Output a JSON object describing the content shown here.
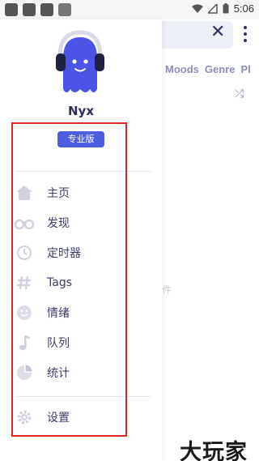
{
  "status_bar": {
    "time": "5:06"
  },
  "background": {
    "tabs": [
      "Moods",
      "Genre",
      "Pl"
    ],
    "faint_text": "件"
  },
  "drawer": {
    "app_name": "Nyx",
    "pro_badge": "专业版",
    "menu": [
      {
        "label": "主页",
        "icon": "home-icon"
      },
      {
        "label": "发现",
        "icon": "binoculars-icon"
      },
      {
        "label": "定时器",
        "icon": "clock-icon"
      },
      {
        "label": "Tags",
        "icon": "hash-icon"
      },
      {
        "label": "情绪",
        "icon": "smile-icon"
      },
      {
        "label": "队列",
        "icon": "music-note-icon"
      },
      {
        "label": "统计",
        "icon": "pie-chart-icon"
      }
    ],
    "settings": {
      "label": "设置",
      "icon": "gear-icon"
    }
  },
  "watermark": "大玩家",
  "colors": {
    "accent": "#4b5de0",
    "text": "#3a3d66",
    "icon": "#cfd1de",
    "highlight": "#e02424"
  }
}
